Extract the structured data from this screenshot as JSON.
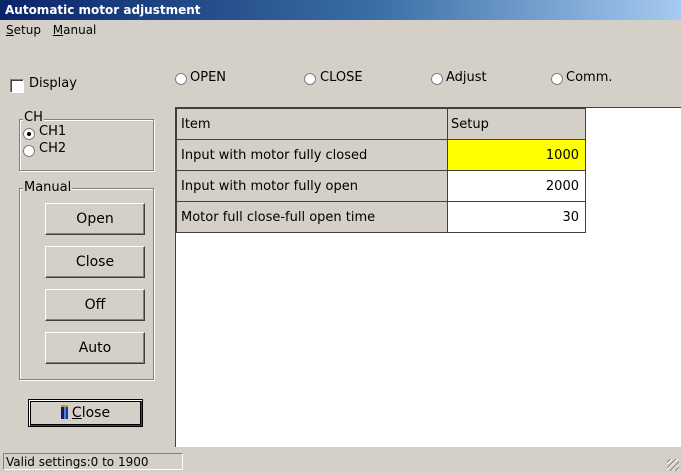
{
  "window": {
    "title": "Automatic motor adjustment"
  },
  "menu": {
    "setup": {
      "mnemonic": "S",
      "rest": "etup"
    },
    "manual": {
      "mnemonic": "M",
      "rest": "anual"
    }
  },
  "display_checkbox": {
    "label": "Display",
    "checked": false
  },
  "mode_options": [
    {
      "label": "OPEN",
      "selected": false
    },
    {
      "label": "CLOSE",
      "selected": false
    },
    {
      "label": "Adjust",
      "selected": false
    },
    {
      "label": "Comm.",
      "selected": false
    }
  ],
  "channel_group": {
    "title": "CH",
    "options": [
      {
        "label": "CH1",
        "selected": true
      },
      {
        "label": "CH2",
        "selected": false
      }
    ]
  },
  "manual_group": {
    "title": "Manual",
    "buttons": [
      "Open",
      "Close",
      "Off",
      "Auto"
    ]
  },
  "close_button": {
    "mnemonic": "C",
    "rest": "lose",
    "icon": "door-icon"
  },
  "table": {
    "headers": [
      "Item",
      "Setup"
    ],
    "rows": [
      {
        "item": "Input with motor fully closed",
        "value": "1000",
        "highlight": true
      },
      {
        "item": "Input with motor fully open",
        "value": "2000",
        "highlight": false
      },
      {
        "item": "Motor full close-full open time",
        "value": "30",
        "highlight": false
      }
    ],
    "highlight_color": "#ffff00"
  },
  "status": {
    "text": "Valid settings:0 to 1900"
  }
}
